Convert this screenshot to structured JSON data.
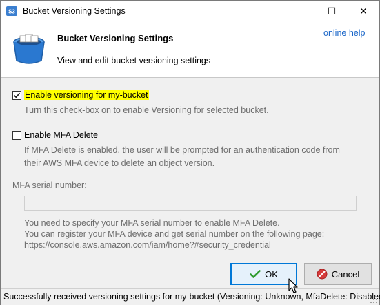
{
  "window": {
    "title": "Bucket Versioning Settings",
    "controls": {
      "minimize": "—",
      "maximize": "☐",
      "close": "✕"
    }
  },
  "header": {
    "title": "Bucket Versioning Settings",
    "subtitle": "View and edit bucket versioning settings",
    "help_link": "online help"
  },
  "versioning": {
    "checked": true,
    "label": "Enable versioning for my-bucket",
    "description": "Turn this check-box on to enable Versioning for selected bucket."
  },
  "mfa_delete": {
    "checked": false,
    "label": "Enable MFA Delete",
    "description_line1": "If MFA Delete is enabled, the user will be prompted for an authentication code from",
    "description_line2": "their AWS MFA device to delete an object version."
  },
  "mfa_serial": {
    "label": "MFA serial number:",
    "value": "",
    "help_line1": "You need to specify your MFA serial number to enable MFA Delete.",
    "help_line2": "You can register your MFA device and get serial number on the following page:",
    "help_line3": "https://console.aws.amazon.com/iam/home?#security_credential"
  },
  "buttons": {
    "ok": "OK",
    "cancel": "Cancel"
  },
  "status": {
    "text": "Successfully received versioning settings for my-bucket (Versioning: Unknown, MfaDelete: Disabled)"
  },
  "colors": {
    "link": "#1a66c8",
    "highlight": "#ffff00",
    "ok_border": "#0078d7",
    "disabled_text": "#6d6d6d"
  }
}
